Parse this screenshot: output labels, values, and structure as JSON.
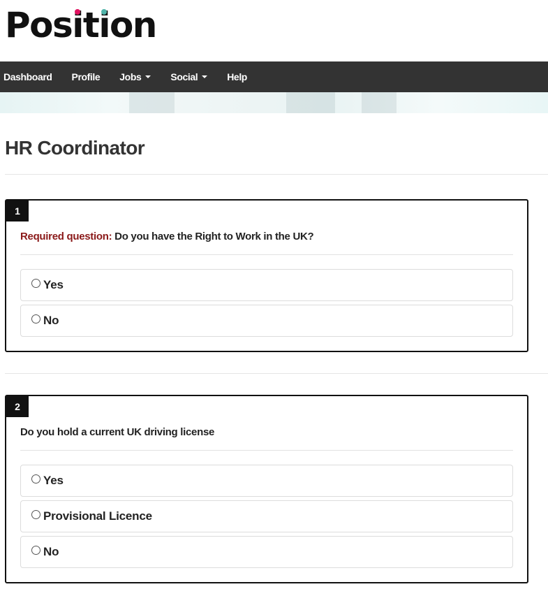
{
  "brand": {
    "logo_text_before": "Pos",
    "logo_i1": "i",
    "logo_middle": "t",
    "logo_i2": "i",
    "logo_text_after": "on",
    "dot_colors": [
      "#e0115f",
      "#4fb3a9"
    ]
  },
  "nav": {
    "items": [
      {
        "label": "Dashboard",
        "has_caret": false
      },
      {
        "label": "Profile",
        "has_caret": false
      },
      {
        "label": "Jobs",
        "has_caret": true
      },
      {
        "label": "Social",
        "has_caret": true
      },
      {
        "label": "Help",
        "has_caret": false
      }
    ]
  },
  "page": {
    "title": "HR Coordinator"
  },
  "questions": [
    {
      "number": "1",
      "required_prefix": "Required question:",
      "text": "Do you have the Right to Work in the UK?",
      "options": [
        "Yes",
        "No"
      ]
    },
    {
      "number": "2",
      "required_prefix": "",
      "text": "Do you hold a current UK driving license",
      "options": [
        "Yes",
        "Provisional Licence",
        "No"
      ]
    }
  ],
  "colors": {
    "nav_background": "#333333",
    "required_text": "#8b1a1a",
    "question_border": "#111111"
  }
}
